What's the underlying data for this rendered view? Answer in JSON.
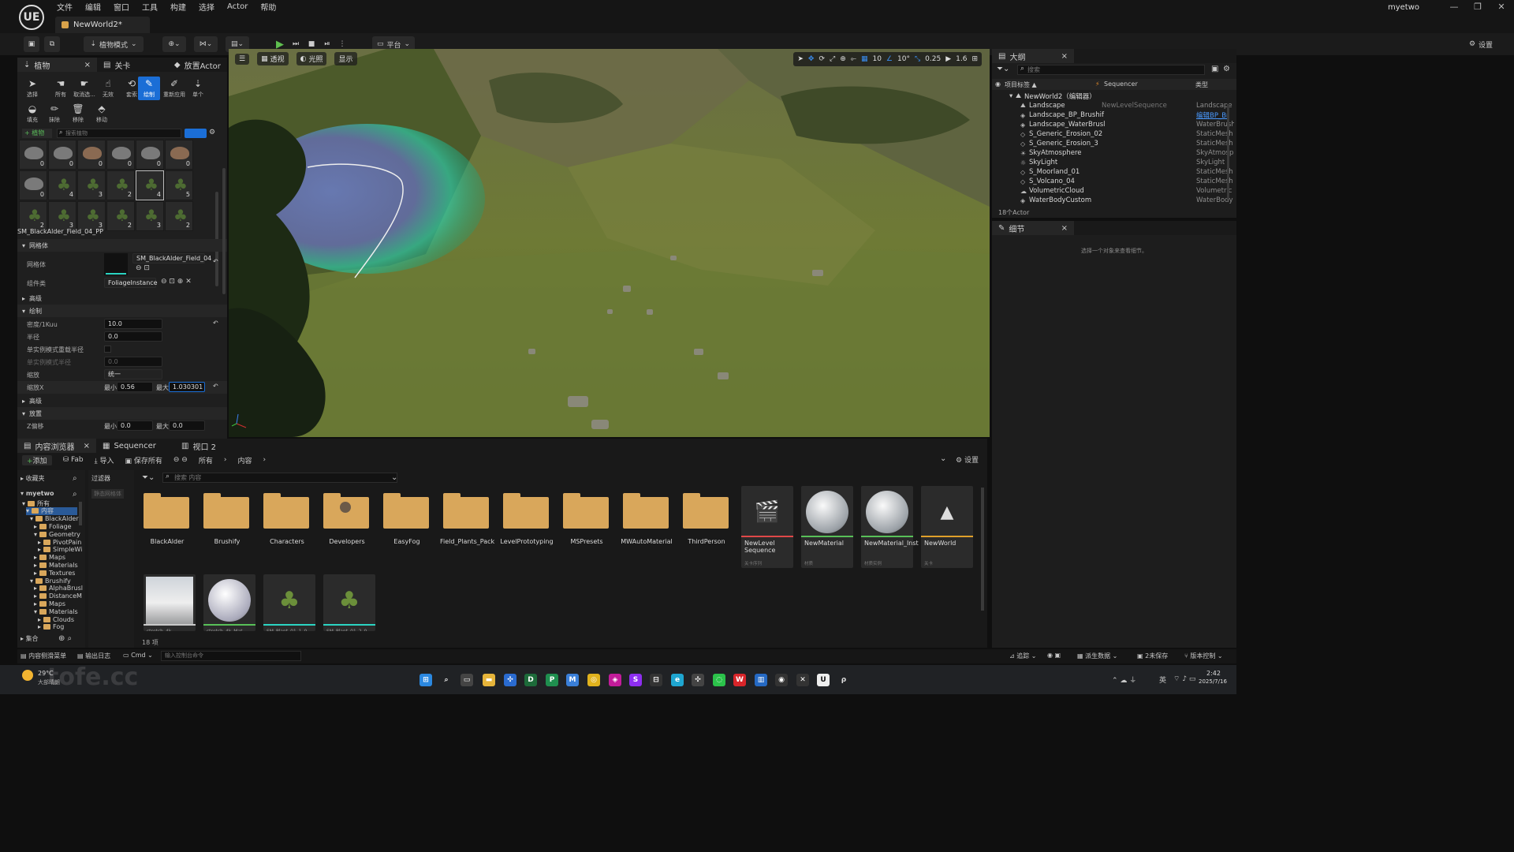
{
  "window": {
    "logo": "UE",
    "menu": [
      "文件",
      "编辑",
      "窗口",
      "工具",
      "构建",
      "选择",
      "Actor",
      "帮助"
    ],
    "doc_tab": "NewWorld2*",
    "user": "myetwo",
    "controls": [
      "—",
      "❐",
      "✕"
    ]
  },
  "toolbar": {
    "mode": "植物模式",
    "platform": "平台",
    "settings": "设置"
  },
  "foliage": {
    "tabs": [
      "植物",
      "关卡",
      "放置Actor"
    ],
    "tools": [
      "选择",
      "所有",
      "取消选...",
      "无效",
      "套索",
      "绘制",
      "重新应用",
      "单个",
      "填充",
      "抹除",
      "移除",
      "移动"
    ],
    "toolbar": {
      "add": "+ 植物",
      "search_placeholder": "搜索植物"
    },
    "thumbs": [
      {
        "k": "rock",
        "c": "0"
      },
      {
        "k": "rock",
        "c": "0"
      },
      {
        "k": "rock2",
        "c": "0"
      },
      {
        "k": "rock",
        "c": "0"
      },
      {
        "k": "rock",
        "c": "0"
      },
      {
        "k": "rock2",
        "c": "0"
      },
      {
        "k": "rock",
        "c": "0"
      },
      {
        "k": "plant",
        "c": "4"
      },
      {
        "k": "plant",
        "c": "3"
      },
      {
        "k": "plant",
        "c": "2"
      },
      {
        "k": "plant",
        "c": "4"
      },
      {
        "k": "plant",
        "c": "5"
      },
      {
        "k": "plant",
        "c": "2"
      },
      {
        "k": "plant",
        "c": "3"
      },
      {
        "k": "plant",
        "c": "3"
      },
      {
        "k": "plant",
        "c": "2"
      },
      {
        "k": "plant",
        "c": "3"
      },
      {
        "k": "plant",
        "c": "2"
      }
    ],
    "selected_name": "SM_BlackAlder_Field_04_PP",
    "sections": {
      "mesh": "网格体",
      "advanced": "高级",
      "paint": "绘制",
      "advanced2": "高级",
      "placement": "放置"
    },
    "mesh_label": "网格体",
    "mesh_value": "SM_BlackAlder_Field_04",
    "component_label": "组件类",
    "component_value": "FoliageInstance",
    "density_label": "密度/1Kuu",
    "density": "10.0",
    "radius_label": "半径",
    "radius": "0.0",
    "single_mode_label": "单实例模式重载半径",
    "single_radius_label": "单实例模式半径",
    "single_radius": "0.0",
    "scaling_label": "缩放",
    "scaling": "统一",
    "scale_x_label": "缩放X",
    "min_label": "最小",
    "max_label": "最大",
    "scale_min": "0.56",
    "scale_max": "1.030301",
    "z_offset_label": "Z偏移",
    "z_min": "0.0",
    "z_max": "0.0"
  },
  "viewport": {
    "perspective": "透视",
    "lit": "光照",
    "show": "显示",
    "grid_snap": "10",
    "rot_snap": "10°",
    "scale_snap": "0.25",
    "cam_speed": "1.6"
  },
  "outliner": {
    "title": "大纲",
    "search_placeholder": "搜索",
    "col_label": "项目标签 ▲",
    "col_seq": "Sequencer",
    "col_type": "类型",
    "root": "NewWorld2（编辑器）",
    "items": [
      {
        "icon": "⛰",
        "name": "Landscape",
        "seq": "NewLevelSequence",
        "type": "Landscape"
      },
      {
        "icon": "◈",
        "name": "Landscape_BP_Brushif",
        "seq": "",
        "type": "编辑BP_Br"
      },
      {
        "icon": "◈",
        "name": "Landscape_WaterBrusl",
        "seq": "",
        "type": "WaterBrush"
      },
      {
        "icon": "◇",
        "name": "S_Generic_Erosion_02",
        "seq": "",
        "type": "StaticMesh"
      },
      {
        "icon": "◇",
        "name": "S_Generic_Erosion_3",
        "seq": "",
        "type": "StaticMesh"
      },
      {
        "icon": "☀",
        "name": "SkyAtmosphere",
        "seq": "",
        "type": "SkyAtmosp"
      },
      {
        "icon": "☼",
        "name": "SkyLight",
        "seq": "",
        "type": "SkyLight"
      },
      {
        "icon": "◇",
        "name": "S_Moorland_01",
        "seq": "",
        "type": "StaticMesh"
      },
      {
        "icon": "◇",
        "name": "S_Volcano_04",
        "seq": "",
        "type": "StaticMesh"
      },
      {
        "icon": "☁",
        "name": "VolumetricCloud",
        "seq": "",
        "type": "Volumetric"
      },
      {
        "icon": "◈",
        "name": "WaterBodyCustom",
        "seq": "",
        "type": "WaterBody"
      }
    ],
    "count": "18个Actor"
  },
  "details": {
    "title": "细节",
    "empty": "选择一个对象来查看细节。"
  },
  "content": {
    "tabs": [
      "内容浏览器",
      "Sequencer",
      "视口 2"
    ],
    "add": "添加",
    "fab": "Fab",
    "import": "导入",
    "save_all": "保存所有",
    "path": [
      "所有",
      "内容"
    ],
    "settings": "设置",
    "favorites": "收藏夹",
    "filters": "过滤器",
    "filter_chip": "静态网格体",
    "search_placeholder": "搜索 内容",
    "project": "myetwo",
    "collections": "集合",
    "tree": [
      "所有",
      "内容",
      "BlackAlder",
      "Foliage",
      "Geometry",
      "PivotPain",
      "SimpleWi",
      "Maps",
      "Materials",
      "Textures",
      "Brushify",
      "AlphaBrusl",
      "DistanceM",
      "Maps",
      "Materials",
      "Clouds",
      "Fog"
    ],
    "folders": [
      "BlackAlder",
      "Brushify",
      "Characters",
      "Developers",
      "EasyFog",
      "Field_Plants_Pack",
      "LevelPrototyping",
      "MSPresets",
      "MWAutoMaterial",
      "ThirdPerson"
    ],
    "assets": [
      {
        "name": "NewLevel Sequence",
        "sub": "关卡序列"
      },
      {
        "name": "NewMaterial",
        "sub": "材质"
      },
      {
        "name": "NewMaterial_Inst",
        "sub": "材质实例"
      },
      {
        "name": "NewWorld",
        "sub": "关卡"
      }
    ],
    "assets2": [
      "stretch_4k",
      "stretch_4k_Mat",
      "SM_Plant_01_1_0",
      "SM_Plant_01_2_0"
    ],
    "count": "18 项"
  },
  "status": {
    "drawer": "内容侧滑菜单",
    "output": "输出日志",
    "cmd": "Cmd",
    "cmd_placeholder": "输入控制台命令",
    "trace": "追踪",
    "derived": "派生数据",
    "unsaved": "2未保存",
    "source": "版本控制"
  },
  "taskbar": {
    "weather_temp": "29°C",
    "weather_desc": "大部晴朗",
    "watermark": "tofe.cc",
    "time": "2:42",
    "date": "2025/7/16",
    "lang": "英"
  }
}
